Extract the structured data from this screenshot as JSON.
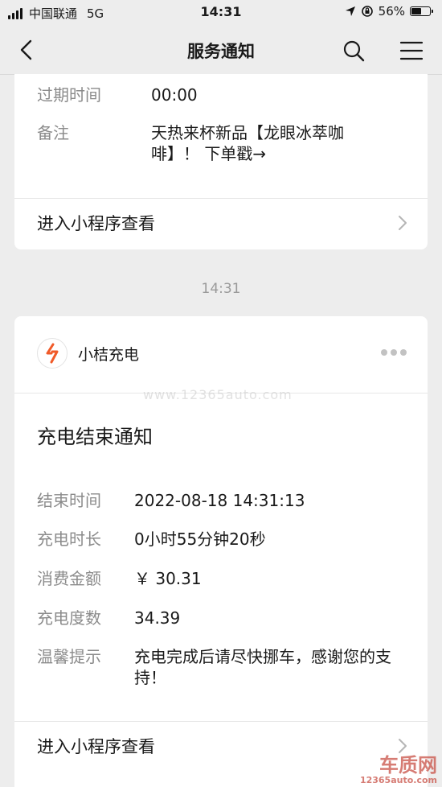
{
  "status_bar": {
    "carrier": "中国联通",
    "network": "5G",
    "time": "14:31",
    "battery_percent_label": "56%",
    "battery_level": 0.56
  },
  "nav": {
    "title": "服务通知",
    "back_icon": "back-chevron-icon",
    "search_icon": "search-icon",
    "menu_icon": "menu-icon"
  },
  "card1": {
    "rows": [
      {
        "label": "过期时间",
        "value": "00:00"
      },
      {
        "label": "备注",
        "value": "天热来杯新品【龙眼冰萃咖啡】！ 下单戳→"
      }
    ],
    "link_label": "进入小程序查看"
  },
  "timestamp": "14:31",
  "card2": {
    "brand_name": "小桔充电",
    "title": "充电结束通知",
    "rows": [
      {
        "label": "结束时间",
        "value": "2022-08-18 14:31:13"
      },
      {
        "label": "充电时长",
        "value": "0小时55分钟20秒"
      },
      {
        "label": "消费金额",
        "value": "￥ 30.31"
      },
      {
        "label": "充电度数",
        "value": "34.39"
      },
      {
        "label": "温馨提示",
        "value": "充电完成后请尽快挪车，感谢您的支持！"
      }
    ],
    "link_label": "进入小程序查看"
  },
  "watermark": "www.12365auto.com",
  "corner_watermark": {
    "big": "车质网",
    "small": "12365auto.com"
  },
  "colors": {
    "background": "#ededed",
    "card": "#ffffff",
    "label": "#8b8b8b",
    "logo_orange": "#f05a28"
  }
}
